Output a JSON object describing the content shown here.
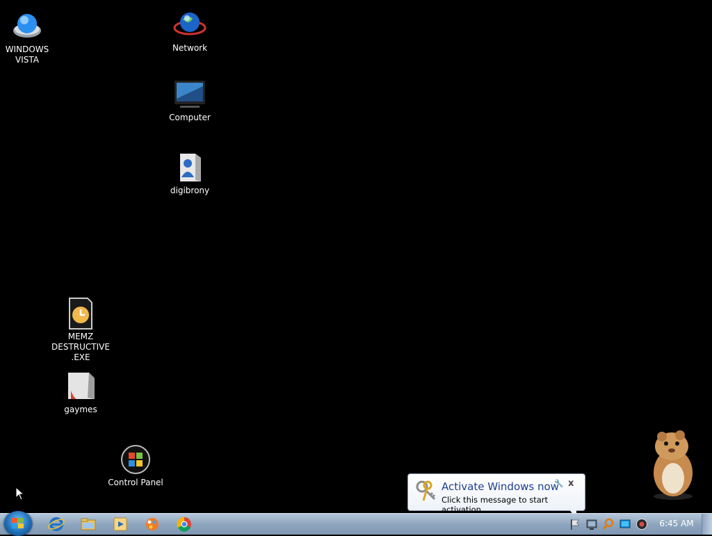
{
  "desktop": {
    "icons": [
      {
        "label": "WINDOWS\nVISTA",
        "icon": "orb-icon"
      },
      {
        "label": "Network",
        "icon": "globe-icon"
      },
      {
        "label": "Computer",
        "icon": "monitor-icon"
      },
      {
        "label": "digibrony",
        "icon": "user-folder-icon"
      },
      {
        "label": "MEMZ\nDESTRUCTIVE\n.EXE",
        "icon": "clock-file-icon"
      },
      {
        "label": "gaymes",
        "icon": "folder-icon"
      },
      {
        "label": "Control Panel",
        "icon": "windows-logo-icon"
      }
    ]
  },
  "taskbar": {
    "pinned": [
      "internet-explorer-icon",
      "file-explorer-icon",
      "media-player-icon",
      "paint-icon",
      "chrome-icon"
    ],
    "tray": [
      "flag-icon",
      "network-icon",
      "search-icon",
      "display-icon",
      "volume-icon"
    ],
    "clock": "6:45 AM"
  },
  "balloon": {
    "title": "Activate Windows now",
    "message": "Click this message to start activation.",
    "close_glyph": "x",
    "options_glyph": "🔧"
  },
  "colors": {
    "desktop_bg": "#000000",
    "taskbar": "#8fa6bf",
    "balloon_title": "#1d3f8f"
  }
}
